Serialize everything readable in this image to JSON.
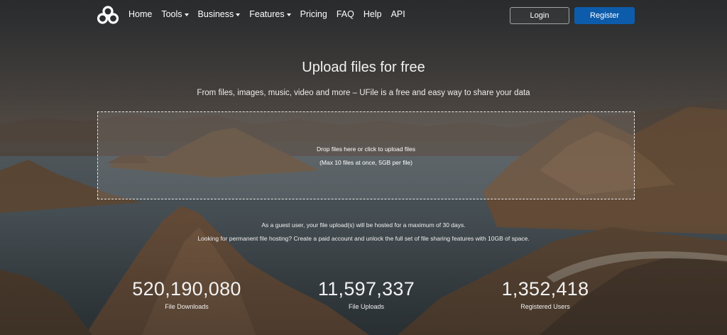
{
  "nav": {
    "logo_icon": "cloud-rings-logo-icon",
    "items": [
      {
        "label": "Home",
        "has_dropdown": false
      },
      {
        "label": "Tools",
        "has_dropdown": true
      },
      {
        "label": "Business",
        "has_dropdown": true
      },
      {
        "label": "Features",
        "has_dropdown": true
      },
      {
        "label": "Pricing",
        "has_dropdown": false
      },
      {
        "label": "FAQ",
        "has_dropdown": false
      },
      {
        "label": "Help",
        "has_dropdown": false
      },
      {
        "label": "API",
        "has_dropdown": false
      }
    ],
    "login_label": "Login",
    "register_label": "Register"
  },
  "hero": {
    "title": "Upload files for free",
    "subtitle": "From files, images, music, video and more – UFile is a free and easy way to share your data"
  },
  "dropzone": {
    "line1": "Drop files here or click to upload files",
    "line2": "(Max 10 files at once, 5GB per file)"
  },
  "notice": {
    "line1": "As a guest user, your file upload(s) will be hosted for a maximum of 30 days.",
    "line2": "Looking for permanent file hosting? Create a paid account and unlock the full set of file sharing features with 10GB of space."
  },
  "stats": [
    {
      "value": "520,190,080",
      "label": "File Downloads"
    },
    {
      "value": "11,597,337",
      "label": "File Uploads"
    },
    {
      "value": "1,352,418",
      "label": "Registered Users"
    }
  ],
  "colors": {
    "register_button": "#0d5cab",
    "text": "#ffffff"
  }
}
